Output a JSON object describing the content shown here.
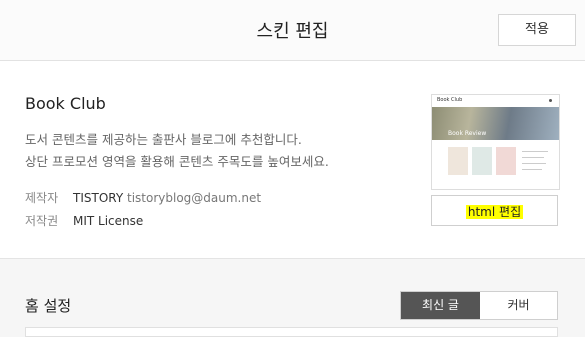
{
  "header": {
    "title": "스킨 편집",
    "apply_label": "적용"
  },
  "skin": {
    "name": "Book Club",
    "description_line1": "도서 콘텐츠를 제공하는 출판사 블로그에 추천합니다.",
    "description_line2": "상단 프로모션 영역을 활용해 콘텐츠 주목도를 높여보세요.",
    "author_label": "제작자",
    "author_name": "TISTORY",
    "author_email": "tistoryblog@daum.net",
    "license_label": "저작권",
    "license_value": "MIT License",
    "preview": {
      "top_text": "Book Club",
      "hero_text": "Book Review"
    },
    "html_edit_label": "html 편집"
  },
  "home_settings": {
    "title": "홈 설정",
    "tabs": [
      {
        "label": "최신 글",
        "active": true
      },
      {
        "label": "커버",
        "active": false
      }
    ]
  }
}
